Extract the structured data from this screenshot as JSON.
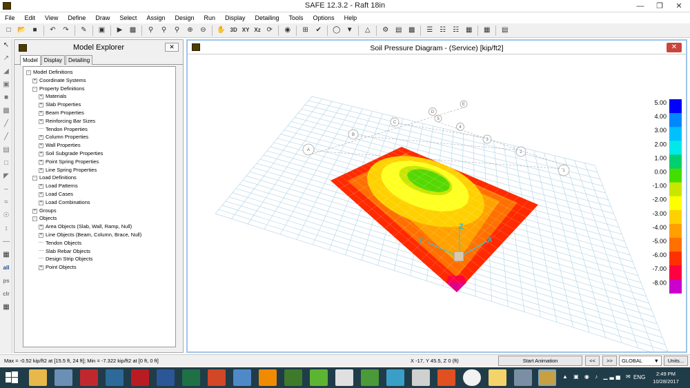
{
  "titlebar": {
    "title": "SAFE 12.3.2 - Raft 18in",
    "min": "—",
    "restore": "❐",
    "close": "✕"
  },
  "menu": [
    "File",
    "Edit",
    "View",
    "Define",
    "Draw",
    "Select",
    "Assign",
    "Design",
    "Run",
    "Display",
    "Detailing",
    "Tools",
    "Options",
    "Help"
  ],
  "toolbar": {
    "view3d": "3D",
    "xy": "XY",
    "xz": "Xz"
  },
  "lefttools": {
    "all": "all",
    "ps": "ps",
    "clr": "clr"
  },
  "explorer": {
    "title": "Model Explorer",
    "close": "✕",
    "tabs": [
      "Model",
      "Display",
      "Detailing"
    ],
    "tree": [
      {
        "label": "Model Definitions",
        "level": 0,
        "exp": "-"
      },
      {
        "label": "Coordinate Systems",
        "level": 1,
        "exp": "+"
      },
      {
        "label": "Property Definitions",
        "level": 1,
        "exp": "-"
      },
      {
        "label": "Materials",
        "level": 2,
        "exp": "+"
      },
      {
        "label": "Slab Properties",
        "level": 2,
        "exp": "+"
      },
      {
        "label": "Beam Properties",
        "level": 2,
        "exp": "+"
      },
      {
        "label": "Reinforcing Bar Sizes",
        "level": 2,
        "exp": "+"
      },
      {
        "label": "Tendon Properties",
        "level": 2,
        "exp": ""
      },
      {
        "label": "Column Properties",
        "level": 2,
        "exp": "+"
      },
      {
        "label": "Wall Properties",
        "level": 2,
        "exp": "+"
      },
      {
        "label": "Soil Subgrade Properties",
        "level": 2,
        "exp": "+"
      },
      {
        "label": "Point Spring Properties",
        "level": 2,
        "exp": "+"
      },
      {
        "label": "Line Spring Properties",
        "level": 2,
        "exp": "+"
      },
      {
        "label": "Load Definitions",
        "level": 1,
        "exp": "-"
      },
      {
        "label": "Load Patterns",
        "level": 2,
        "exp": "+"
      },
      {
        "label": "Load Cases",
        "level": 2,
        "exp": "+"
      },
      {
        "label": "Load Combinations",
        "level": 2,
        "exp": "+"
      },
      {
        "label": "Groups",
        "level": 1,
        "exp": "+"
      },
      {
        "label": "Objects",
        "level": 1,
        "exp": "-"
      },
      {
        "label": "Area Objects (Slab, Wall, Ramp, Null)",
        "level": 2,
        "exp": "+"
      },
      {
        "label": "Line Objects (Beam, Column, Brace, Null)",
        "level": 2,
        "exp": "+"
      },
      {
        "label": "Tendon Objects",
        "level": 2,
        "exp": ""
      },
      {
        "label": "Slab Rebar Objects",
        "level": 2,
        "exp": ""
      },
      {
        "label": "Design Strip Objects",
        "level": 2,
        "exp": ""
      },
      {
        "label": "Point Objects",
        "level": 2,
        "exp": "+"
      }
    ]
  },
  "viewer": {
    "title": "Soil Pressure Diagram - (Service)  [kip/ft2]",
    "close": "✕",
    "grid_labels": [
      "A",
      "B",
      "C",
      "D",
      "E",
      "1",
      "2",
      "3",
      "4",
      "5"
    ],
    "axis_labels": {
      "x": "X",
      "y": "Y",
      "z": "Z"
    },
    "legend": [
      {
        "label": "5.00",
        "color": "#0000ff"
      },
      {
        "label": "4.00",
        "color": "#0088ff"
      },
      {
        "label": "3.00",
        "color": "#00c0ff"
      },
      {
        "label": "2.00",
        "color": "#00e8e8"
      },
      {
        "label": "1.00",
        "color": "#00d070"
      },
      {
        "label": "0.00",
        "color": "#44dd00"
      },
      {
        "label": "-1.00",
        "color": "#c8e600"
      },
      {
        "label": "-2.00",
        "color": "#ffff00"
      },
      {
        "label": "-3.00",
        "color": "#ffd000"
      },
      {
        "label": "-4.00",
        "color": "#ffa000"
      },
      {
        "label": "-5.00",
        "color": "#ff7000"
      },
      {
        "label": "-6.00",
        "color": "#ff3000"
      },
      {
        "label": "-7.00",
        "color": "#ff0040"
      },
      {
        "label": "-8.00",
        "color": "#cc00cc"
      }
    ]
  },
  "status": {
    "text": "Max = -0.52 kip/ft2 at [15.5 ft, 24 ft];  Min = -7.322 kip/ft2 at [0 ft, 0 ft]",
    "coords": "X -17,  Y 45.5,  Z 0  (ft)",
    "animation": "Start Animation",
    "prev": "<<",
    "next": ">>",
    "coordsys": "GLOBAL",
    "units": "Units..."
  },
  "taskbar": {
    "time": "2:49 PM",
    "date": "10/28/2017",
    "lang": "ENG",
    "tray": "▲ ▣ ◉ ♪ ▁▃▅ ✉"
  }
}
